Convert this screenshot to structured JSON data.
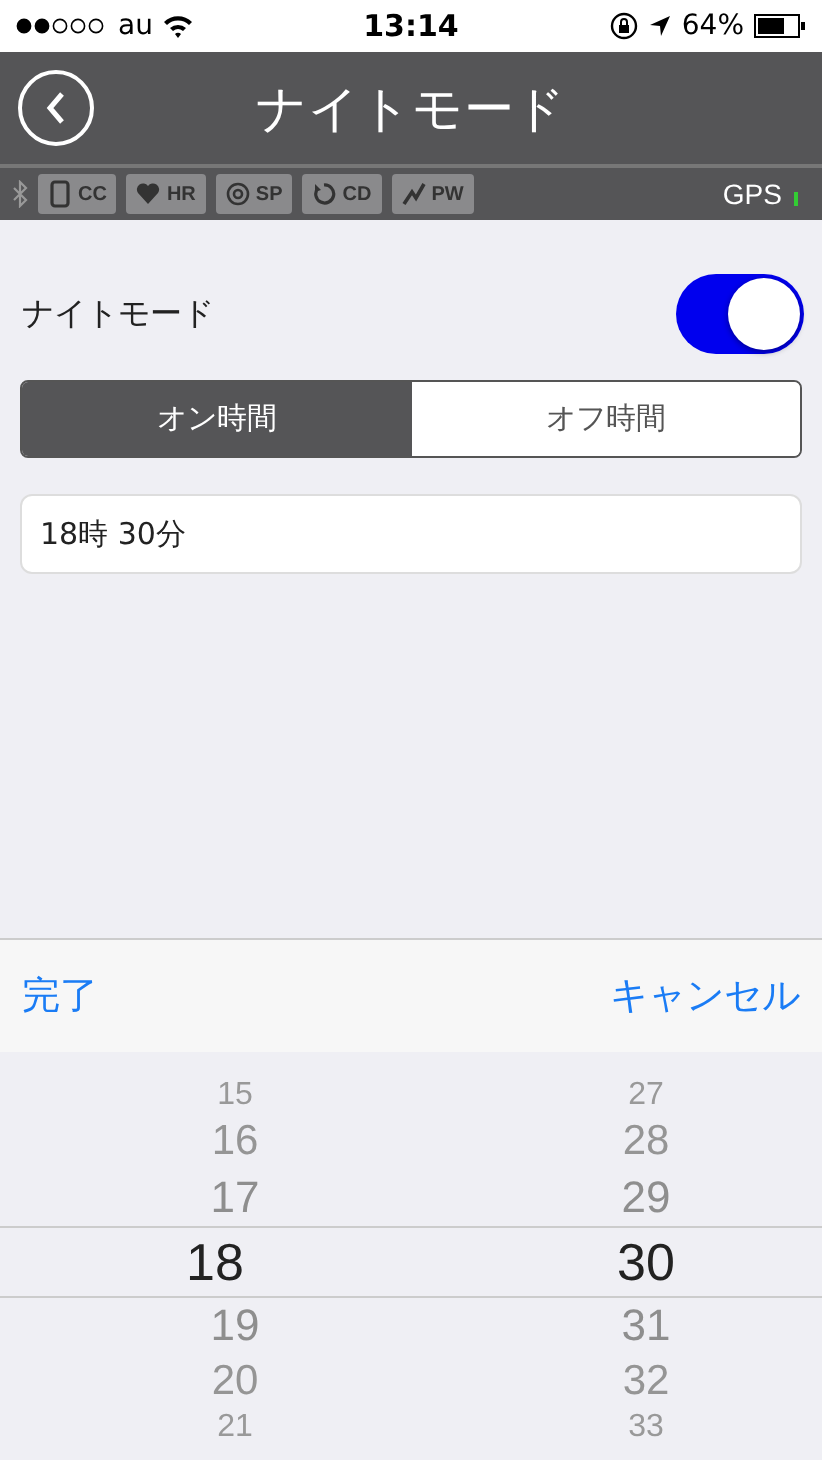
{
  "status_bar": {
    "carrier": "au",
    "time": "13:14",
    "battery": "64%"
  },
  "nav": {
    "title": "ナイトモード"
  },
  "sensors": [
    {
      "kind": "phone",
      "label": "CC"
    },
    {
      "kind": "heart",
      "label": "HR"
    },
    {
      "kind": "target",
      "label": "SP"
    },
    {
      "kind": "cycle",
      "label": "CD"
    },
    {
      "kind": "power",
      "label": "PW"
    }
  ],
  "gps": {
    "label": "GPS"
  },
  "night_mode": {
    "label": "ナイトモード",
    "on": true
  },
  "segments": [
    {
      "label": "オン時間",
      "selected": true
    },
    {
      "label": "オフ時間",
      "selected": false
    }
  ],
  "time_field": {
    "value": "18時 30分"
  },
  "toolbar": {
    "done": "完了",
    "cancel": "キャンセル"
  },
  "picker": {
    "columns": [
      {
        "items": [
          {
            "label": "15",
            "selected": false
          },
          {
            "label": "16",
            "selected": false
          },
          {
            "label": "17",
            "selected": false
          },
          {
            "label": "18",
            "selected": true
          },
          {
            "label": "19",
            "selected": false
          },
          {
            "label": "20",
            "selected": false
          },
          {
            "label": "21",
            "selected": false
          }
        ]
      },
      {
        "items": [
          {
            "label": "27",
            "selected": false
          },
          {
            "label": "28",
            "selected": false
          },
          {
            "label": "29",
            "selected": false
          },
          {
            "label": "30",
            "selected": true
          },
          {
            "label": "31",
            "selected": false
          },
          {
            "label": "32",
            "selected": false
          },
          {
            "label": "33",
            "selected": false
          }
        ]
      }
    ]
  }
}
